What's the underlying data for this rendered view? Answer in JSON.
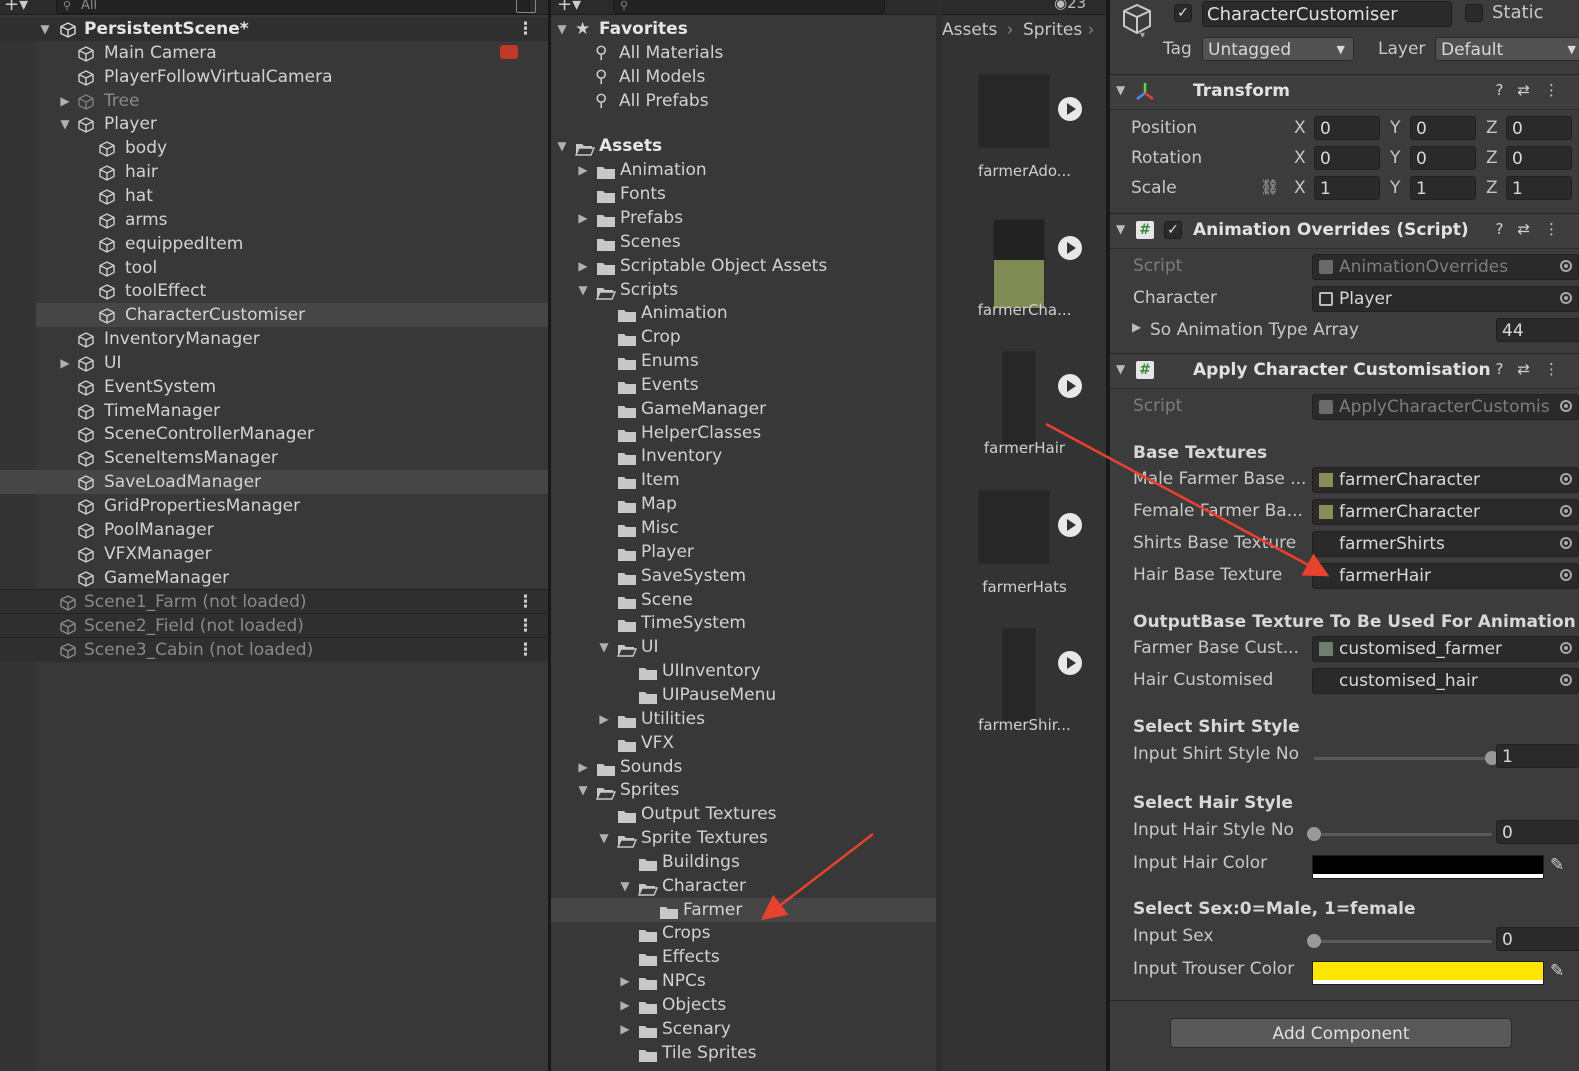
{
  "hierarchy": {
    "search_placeholder": "All",
    "scene": "PersistentScene*",
    "items": [
      {
        "label": "Main Camera",
        "indent": 0,
        "arrow": "",
        "state": "normal"
      },
      {
        "label": "PlayerFollowVirtualCamera",
        "indent": 0,
        "arrow": "",
        "state": "normal"
      },
      {
        "label": "Tree",
        "indent": 0,
        "arrow": "right",
        "state": "dim"
      },
      {
        "label": "Player",
        "indent": 0,
        "arrow": "down",
        "state": "normal"
      },
      {
        "label": "body",
        "indent": 1,
        "arrow": "",
        "state": "normal"
      },
      {
        "label": "hair",
        "indent": 1,
        "arrow": "",
        "state": "normal"
      },
      {
        "label": "hat",
        "indent": 1,
        "arrow": "",
        "state": "normal"
      },
      {
        "label": "arms",
        "indent": 1,
        "arrow": "",
        "state": "normal"
      },
      {
        "label": "equippedItem",
        "indent": 1,
        "arrow": "",
        "state": "normal"
      },
      {
        "label": "tool",
        "indent": 1,
        "arrow": "",
        "state": "normal"
      },
      {
        "label": "toolEffect",
        "indent": 1,
        "arrow": "",
        "state": "normal"
      },
      {
        "label": "CharacterCustomiser",
        "indent": 1,
        "arrow": "",
        "state": "selected"
      },
      {
        "label": "InventoryManager",
        "indent": 0,
        "arrow": "",
        "state": "normal"
      },
      {
        "label": "UI",
        "indent": 0,
        "arrow": "right",
        "state": "normal"
      },
      {
        "label": "EventSystem",
        "indent": 0,
        "arrow": "",
        "state": "normal"
      },
      {
        "label": "TimeManager",
        "indent": 0,
        "arrow": "",
        "state": "normal"
      },
      {
        "label": "SceneControllerManager",
        "indent": 0,
        "arrow": "",
        "state": "normal"
      },
      {
        "label": "SceneItemsManager",
        "indent": 0,
        "arrow": "",
        "state": "normal"
      },
      {
        "label": "SaveLoadManager",
        "indent": 0,
        "arrow": "",
        "state": "hover"
      },
      {
        "label": "GridPropertiesManager",
        "indent": 0,
        "arrow": "",
        "state": "normal"
      },
      {
        "label": "PoolManager",
        "indent": 0,
        "arrow": "",
        "state": "normal"
      },
      {
        "label": "VFXManager",
        "indent": 0,
        "arrow": "",
        "state": "normal"
      },
      {
        "label": "GameManager",
        "indent": 0,
        "arrow": "",
        "state": "normal"
      }
    ],
    "unloaded_scenes": [
      "Scene1_Farm (not loaded)",
      "Scene2_Field (not loaded)",
      "Scene3_Cabin (not loaded)"
    ]
  },
  "project": {
    "favorites_label": "Favorites",
    "favorites": [
      "All Materials",
      "All Models",
      "All Prefabs"
    ],
    "assets_label": "Assets",
    "tree": [
      {
        "label": "Animation",
        "indent": 1,
        "arrow": "right",
        "open": false
      },
      {
        "label": "Fonts",
        "indent": 1,
        "arrow": "",
        "open": false
      },
      {
        "label": "Prefabs",
        "indent": 1,
        "arrow": "right",
        "open": false
      },
      {
        "label": "Scenes",
        "indent": 1,
        "arrow": "",
        "open": false
      },
      {
        "label": "Scriptable Object Assets",
        "indent": 1,
        "arrow": "right",
        "open": false
      },
      {
        "label": "Scripts",
        "indent": 1,
        "arrow": "down",
        "open": true
      },
      {
        "label": "Animation",
        "indent": 2,
        "arrow": "",
        "open": false
      },
      {
        "label": "Crop",
        "indent": 2,
        "arrow": "",
        "open": false
      },
      {
        "label": "Enums",
        "indent": 2,
        "arrow": "",
        "open": false
      },
      {
        "label": "Events",
        "indent": 2,
        "arrow": "",
        "open": false
      },
      {
        "label": "GameManager",
        "indent": 2,
        "arrow": "",
        "open": false
      },
      {
        "label": "HelperClasses",
        "indent": 2,
        "arrow": "",
        "open": false
      },
      {
        "label": "Inventory",
        "indent": 2,
        "arrow": "",
        "open": false
      },
      {
        "label": "Item",
        "indent": 2,
        "arrow": "",
        "open": false
      },
      {
        "label": "Map",
        "indent": 2,
        "arrow": "",
        "open": false
      },
      {
        "label": "Misc",
        "indent": 2,
        "arrow": "",
        "open": false
      },
      {
        "label": "Player",
        "indent": 2,
        "arrow": "",
        "open": false
      },
      {
        "label": "SaveSystem",
        "indent": 2,
        "arrow": "",
        "open": false
      },
      {
        "label": "Scene",
        "indent": 2,
        "arrow": "",
        "open": false
      },
      {
        "label": "TimeSystem",
        "indent": 2,
        "arrow": "",
        "open": false
      },
      {
        "label": "UI",
        "indent": 2,
        "arrow": "down",
        "open": true
      },
      {
        "label": "UIInventory",
        "indent": 3,
        "arrow": "",
        "open": false
      },
      {
        "label": "UIPauseMenu",
        "indent": 3,
        "arrow": "",
        "open": false
      },
      {
        "label": "Utilities",
        "indent": 2,
        "arrow": "right",
        "open": false
      },
      {
        "label": "VFX",
        "indent": 2,
        "arrow": "",
        "open": false
      },
      {
        "label": "Sounds",
        "indent": 1,
        "arrow": "right",
        "open": false
      },
      {
        "label": "Sprites",
        "indent": 1,
        "arrow": "down",
        "open": true
      },
      {
        "label": "Output Textures",
        "indent": 2,
        "arrow": "",
        "open": false
      },
      {
        "label": "Sprite Textures",
        "indent": 2,
        "arrow": "down",
        "open": true
      },
      {
        "label": "Buildings",
        "indent": 3,
        "arrow": "",
        "open": false
      },
      {
        "label": "Character",
        "indent": 3,
        "arrow": "down",
        "open": true
      },
      {
        "label": "Farmer",
        "indent": 4,
        "arrow": "",
        "open": false,
        "selected": true
      },
      {
        "label": "Crops",
        "indent": 3,
        "arrow": "",
        "open": false
      },
      {
        "label": "Effects",
        "indent": 3,
        "arrow": "",
        "open": false
      },
      {
        "label": "NPCs",
        "indent": 3,
        "arrow": "right",
        "open": false
      },
      {
        "label": "Objects",
        "indent": 3,
        "arrow": "right",
        "open": false
      },
      {
        "label": "Scenary",
        "indent": 3,
        "arrow": "right",
        "open": false
      },
      {
        "label": "Tile Sprites",
        "indent": 3,
        "arrow": "",
        "open": false
      }
    ]
  },
  "assets": {
    "breadcrumb": [
      "Assets",
      "Sprites"
    ],
    "count": "23",
    "items": [
      {
        "label": "farmerAdo...",
        "variant": "dark"
      },
      {
        "label": "farmerCha...",
        "variant": "olive"
      },
      {
        "label": "farmerHair",
        "variant": "tall"
      },
      {
        "label": "farmerHats",
        "variant": "dark"
      },
      {
        "label": "farmerShir...",
        "variant": "tall"
      }
    ]
  },
  "inspector": {
    "object_name": "CharacterCustomiser",
    "static_label": "Static",
    "tag_label": "Tag",
    "tag_value": "Untagged",
    "layer_label": "Layer",
    "layer_value": "Default",
    "transform": {
      "title": "Transform",
      "rows": [
        {
          "label": "Position",
          "x": "0",
          "y": "0",
          "z": "0"
        },
        {
          "label": "Rotation",
          "x": "0",
          "y": "0",
          "z": "0"
        },
        {
          "label": "Scale",
          "x": "1",
          "y": "1",
          "z": "1"
        }
      ]
    },
    "anim_overrides": {
      "title": "Animation Overrides (Script)",
      "script_label": "Script",
      "script_value": "AnimationOverrides",
      "character_label": "Character",
      "character_value": "Player",
      "array_label": "So Animation Type Array",
      "array_value": "44"
    },
    "apply_custom": {
      "title": "Apply Character Customisation",
      "script_label": "Script",
      "script_value": "ApplyCharacterCustomis",
      "base_textures_header": "Base Textures",
      "male_label": "Male Farmer Base ...",
      "male_value": "farmerCharacter",
      "female_label": "Female Farmer Ba...",
      "female_value": "farmerCharacter",
      "shirts_label": "Shirts Base Texture",
      "shirts_value": "farmerShirts",
      "hair_label": "Hair Base Texture",
      "hair_value": "farmerHair",
      "output_header": "OutputBase Texture To Be Used For Animation",
      "farmer_cust_label": "Farmer Base Cust...",
      "farmer_cust_value": "customised_farmer",
      "hair_cust_label": "Hair Customised",
      "hair_cust_value": "customised_hair",
      "shirt_header": "Select Shirt Style",
      "shirt_label": "Input Shirt Style No",
      "shirt_value": "1",
      "shirt_fraction": 1,
      "hairstyle_header": "Select Hair Style",
      "hairstyle_label": "Input Hair Style No",
      "hairstyle_value": "0",
      "hairstyle_fraction": 0,
      "haircolor_label": "Input Hair Color",
      "haircolor_value": "#000000",
      "sex_header": "Select Sex:0=Male, 1=female",
      "sex_label": "Input Sex",
      "sex_value": "0",
      "sex_fraction": 0,
      "trouser_label": "Input Trouser Color",
      "trouser_value": "#ffe600"
    },
    "add_component": "Add Component"
  },
  "colors": {
    "annotation_arrow": "#e8412e",
    "selection": "#464646"
  }
}
